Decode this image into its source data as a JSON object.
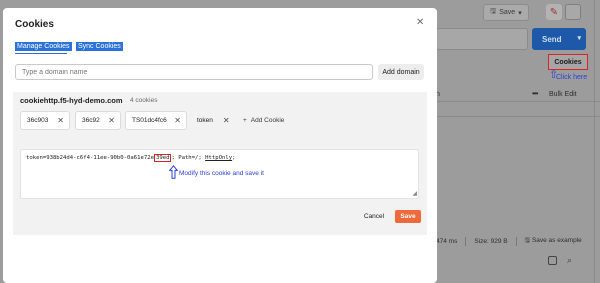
{
  "background": {
    "save_label": "Save",
    "send_label": "Send",
    "cookies_label": "Cookies",
    "click_here": "Click here",
    "column_partial": "n",
    "bulk_edit": "Bulk Edit",
    "status_time": "474 ms",
    "status_size": "Size: 929 B",
    "save_as_example": "Save as example"
  },
  "modal": {
    "title": "Cookies",
    "tabs": [
      "Manage Cookies",
      "Sync Cookies"
    ],
    "domain_placeholder": "Type a domain name",
    "add_domain_label": "Add domain",
    "domain": {
      "name": "cookiehttp.f5-hyd-demo.com",
      "count": "4 cookies",
      "chips": [
        "36c903",
        "36c92",
        "TS01dc4fc6",
        "token"
      ],
      "add_cookie_label": "Add Cookie"
    },
    "cookie_value": {
      "prefix": "token=938b24d4-c6f4-11ee-90b0-0a61e72e",
      "highlighted": "39ed",
      "middle": "; Path=/; ",
      "httponly": "HttpOnly",
      "suffix": ";"
    },
    "annotation": "Modify this cookie  and save it",
    "cancel_label": "Cancel",
    "save_label": "Save"
  },
  "colors": {
    "accent_blue": "#2a71d9",
    "save_orange": "#ef6a3b",
    "annotation_blue": "#2d3fd4",
    "highlight_red": "#d8232a"
  }
}
